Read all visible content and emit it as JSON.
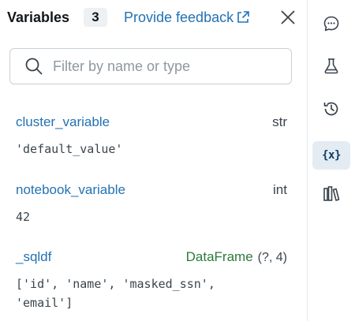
{
  "header": {
    "title": "Variables",
    "count": "3",
    "feedback_label": "Provide feedback"
  },
  "filter": {
    "placeholder": "Filter by name or type",
    "value": ""
  },
  "variables": [
    {
      "name": "cluster_variable",
      "type": "str",
      "value": "'default_value'"
    },
    {
      "name": "notebook_variable",
      "type": "int",
      "value": "42"
    },
    {
      "name": "_sqldf",
      "type": "DataFrame",
      "shape": "(?, 4)",
      "value": "['id', 'name', 'masked_ssn',\n'email']"
    }
  ],
  "sidebar": {
    "items": [
      {
        "icon": "chat-bubble-icon",
        "active": false
      },
      {
        "icon": "flask-icon",
        "active": false
      },
      {
        "icon": "history-icon",
        "active": false
      },
      {
        "icon": "variables-icon",
        "label": "{x}",
        "active": true
      },
      {
        "icon": "library-icon",
        "active": false
      }
    ]
  },
  "colors": {
    "link": "#2272b4",
    "dataframe_type": "#2b7a3a",
    "active_bg": "#e3ebf3"
  }
}
